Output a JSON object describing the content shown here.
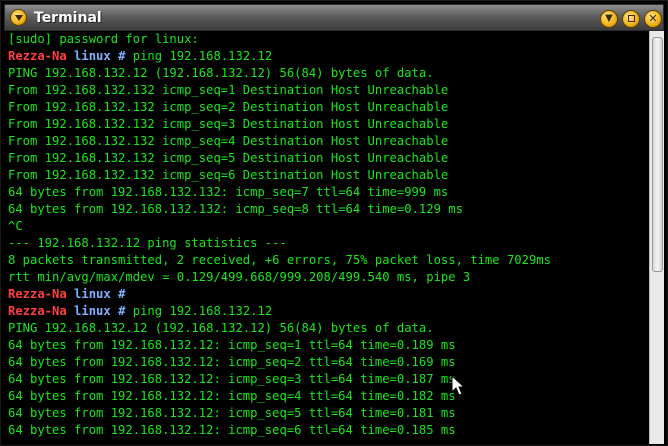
{
  "window": {
    "title": "Terminal"
  },
  "colors": {
    "prompt_host": "#ff4040",
    "prompt_dir": "#7fb0ff",
    "output": "#19e619"
  },
  "terminal": {
    "lines": [
      {
        "type": "text",
        "text": "[sudo] password for linux:"
      },
      {
        "type": "prompt",
        "host": "Rezza-Na",
        "dir": "linux",
        "symbol": "#",
        "cmd": " ping 192.168.132.12"
      },
      {
        "type": "text",
        "text": "PING 192.168.132.12 (192.168.132.12) 56(84) bytes of data."
      },
      {
        "type": "text",
        "text": "From 192.168.132.132 icmp_seq=1 Destination Host Unreachable"
      },
      {
        "type": "text",
        "text": "From 192.168.132.132 icmp_seq=2 Destination Host Unreachable"
      },
      {
        "type": "text",
        "text": "From 192.168.132.132 icmp_seq=3 Destination Host Unreachable"
      },
      {
        "type": "text",
        "text": "From 192.168.132.132 icmp_seq=4 Destination Host Unreachable"
      },
      {
        "type": "text",
        "text": "From 192.168.132.132 icmp_seq=5 Destination Host Unreachable"
      },
      {
        "type": "text",
        "text": "From 192.168.132.132 icmp_seq=6 Destination Host Unreachable"
      },
      {
        "type": "text",
        "text": "64 bytes from 192.168.132.132: icmp_seq=7 ttl=64 time=999 ms"
      },
      {
        "type": "text",
        "text": "64 bytes from 192.168.132.132: icmp_seq=8 ttl=64 time=0.129 ms"
      },
      {
        "type": "text",
        "text": "^C"
      },
      {
        "type": "text",
        "text": "--- 192.168.132.12 ping statistics ---"
      },
      {
        "type": "text",
        "text": "8 packets transmitted, 2 received, +6 errors, 75% packet loss, time 7029ms"
      },
      {
        "type": "text",
        "text": "rtt min/avg/max/mdev = 0.129/499.668/999.208/499.540 ms, pipe 3"
      },
      {
        "type": "prompt",
        "host": "Rezza-Na",
        "dir": "linux",
        "symbol": "#",
        "cmd": ""
      },
      {
        "type": "prompt",
        "host": "Rezza-Na",
        "dir": "linux",
        "symbol": "#",
        "cmd": " ping 192.168.132.12"
      },
      {
        "type": "text",
        "text": "PING 192.168.132.12 (192.168.132.12) 56(84) bytes of data."
      },
      {
        "type": "text",
        "text": "64 bytes from 192.168.132.12: icmp_seq=1 ttl=64 time=0.189 ms"
      },
      {
        "type": "text",
        "text": "64 bytes from 192.168.132.12: icmp_seq=2 ttl=64 time=0.169 ms"
      },
      {
        "type": "text",
        "text": "64 bytes from 192.168.132.12: icmp_seq=3 ttl=64 time=0.187 ms"
      },
      {
        "type": "text",
        "text": "64 bytes from 192.168.132.12: icmp_seq=4 ttl=64 time=0.182 ms"
      },
      {
        "type": "text",
        "text": "64 bytes from 192.168.132.12: icmp_seq=5 ttl=64 time=0.181 ms"
      },
      {
        "type": "text",
        "text": "64 bytes from 192.168.132.12: icmp_seq=6 ttl=64 time=0.185 ms"
      }
    ]
  }
}
